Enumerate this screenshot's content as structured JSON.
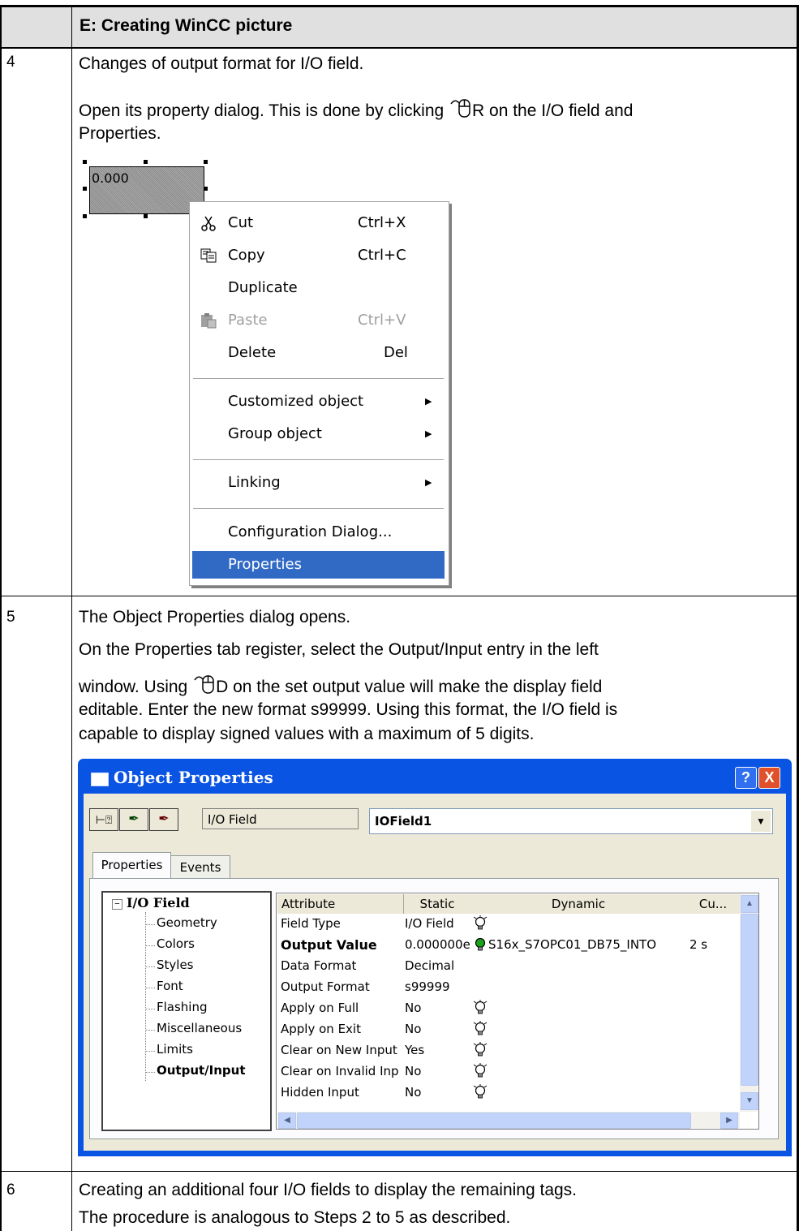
{
  "section_title": "E: Creating WinCC picture",
  "steps": [
    {
      "num": "4",
      "line1": "Changes of output format for I/O field.",
      "line2a": "Open its property dialog. This is done by clicking ",
      "line2b": "R on the I/O field and",
      "line3": "Properties."
    },
    {
      "num": "5",
      "line1": "The Object Properties dialog opens.",
      "line2": "On the Properties tab register, select the Output/Input entry in the left",
      "line3a": "window. Using ",
      "line3b": "D on the set output value will make the display field",
      "line4": "editable. Enter the new format s99999. Using this format, the I/O field is",
      "line5": "capable to display signed values with a maximum of 5 digits."
    },
    {
      "num": "6",
      "line1": "Creating an additional four I/O fields to display the remaining tags.",
      "line2": "The procedure is analogous to Steps 2 to 5 as described."
    }
  ],
  "io_sample_value": "0.000",
  "context_menu": [
    {
      "label": "Cut",
      "shortcut": "Ctrl+X",
      "icon": "scissors-icon"
    },
    {
      "label": "Copy",
      "shortcut": "Ctrl+C",
      "icon": "copy-icon"
    },
    {
      "label": "Duplicate",
      "shortcut": ""
    },
    {
      "label": "Paste",
      "shortcut": "Ctrl+V",
      "icon": "paste-icon",
      "disabled": true
    },
    {
      "label": "Delete",
      "shortcut": "Del"
    },
    {
      "label": "Customized object",
      "submenu": true
    },
    {
      "label": "Group object",
      "submenu": true
    },
    {
      "label": "Linking",
      "submenu": true
    },
    {
      "label": "Configuration Dialog...",
      "shortcut": ""
    },
    {
      "label": "Properties",
      "selected": true
    }
  ],
  "dialog": {
    "title": "Object Properties",
    "help": "?",
    "close": "X",
    "object_type": "I/O Field",
    "object_name": "IOField1",
    "tabs": [
      "Properties",
      "Events"
    ],
    "tree_root": "I/O Field",
    "tree_items": [
      "Geometry",
      "Colors",
      "Styles",
      "Font",
      "Flashing",
      "Miscellaneous",
      "Limits",
      "Output/Input"
    ],
    "columns": [
      "Attribute",
      "Static",
      "Dynamic",
      "Cu..."
    ],
    "rows": [
      {
        "attr": "Field Type",
        "static": "I/O Field",
        "bulb": true,
        "dynamic": "",
        "cu": ""
      },
      {
        "attr": "Output Value",
        "static": "0.000000e",
        "bulb": "green",
        "dynamic": "S16x_S7OPC01_DB75_INTO",
        "cu": "2 s",
        "bold": true
      },
      {
        "attr": "Data Format",
        "static": "Decimal",
        "bulb": false,
        "dynamic": "",
        "cu": ""
      },
      {
        "attr": "Output Format",
        "static": "s99999",
        "bulb": false,
        "dynamic": "",
        "cu": ""
      },
      {
        "attr": "Apply on Full",
        "static": "No",
        "bulb": true,
        "dynamic": "",
        "cu": ""
      },
      {
        "attr": "Apply on Exit",
        "static": "No",
        "bulb": true,
        "dynamic": "",
        "cu": ""
      },
      {
        "attr": "Clear on New Input",
        "static": "Yes",
        "bulb": true,
        "dynamic": "",
        "cu": ""
      },
      {
        "attr": "Clear on Invalid Inp",
        "static": "No",
        "bulb": true,
        "dynamic": "",
        "cu": ""
      },
      {
        "attr": "Hidden Input",
        "static": "No",
        "bulb": true,
        "dynamic": "",
        "cu": ""
      }
    ]
  }
}
